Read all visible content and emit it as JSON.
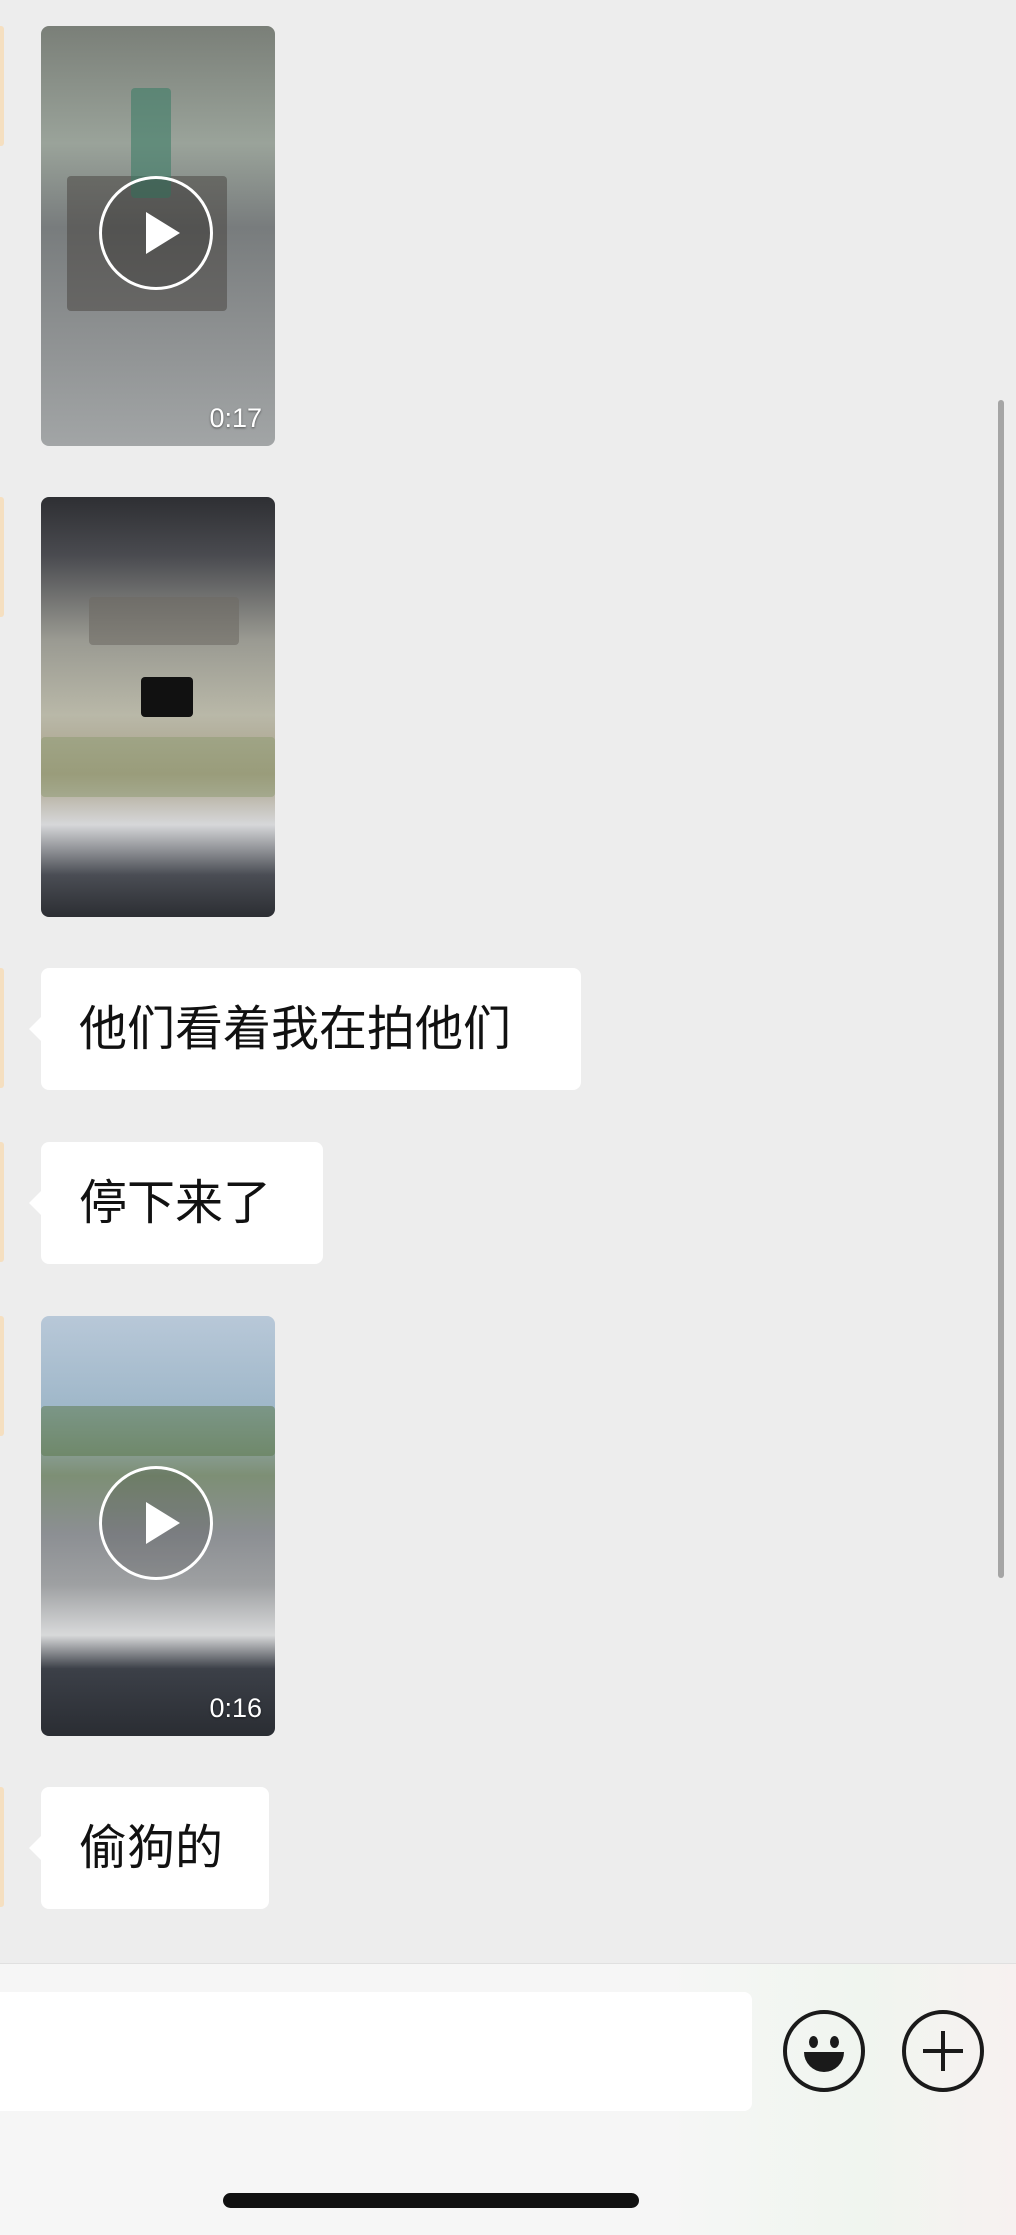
{
  "chat": {
    "messages": [
      {
        "type": "video",
        "duration": "0:17"
      },
      {
        "type": "video",
        "duration": ""
      },
      {
        "type": "text",
        "text": "他们看着我在拍他们"
      },
      {
        "type": "text",
        "text": "停下来了"
      },
      {
        "type": "video",
        "duration": "0:16"
      },
      {
        "type": "text",
        "text": "偷狗的"
      }
    ]
  },
  "input_bar": {
    "text_value": "",
    "emoji_icon": "smiley-face-icon",
    "more_icon": "plus-circle-icon"
  },
  "colors": {
    "background": "#ededed",
    "bubble": "#ffffff",
    "input_bar": "#f6f6f6"
  }
}
